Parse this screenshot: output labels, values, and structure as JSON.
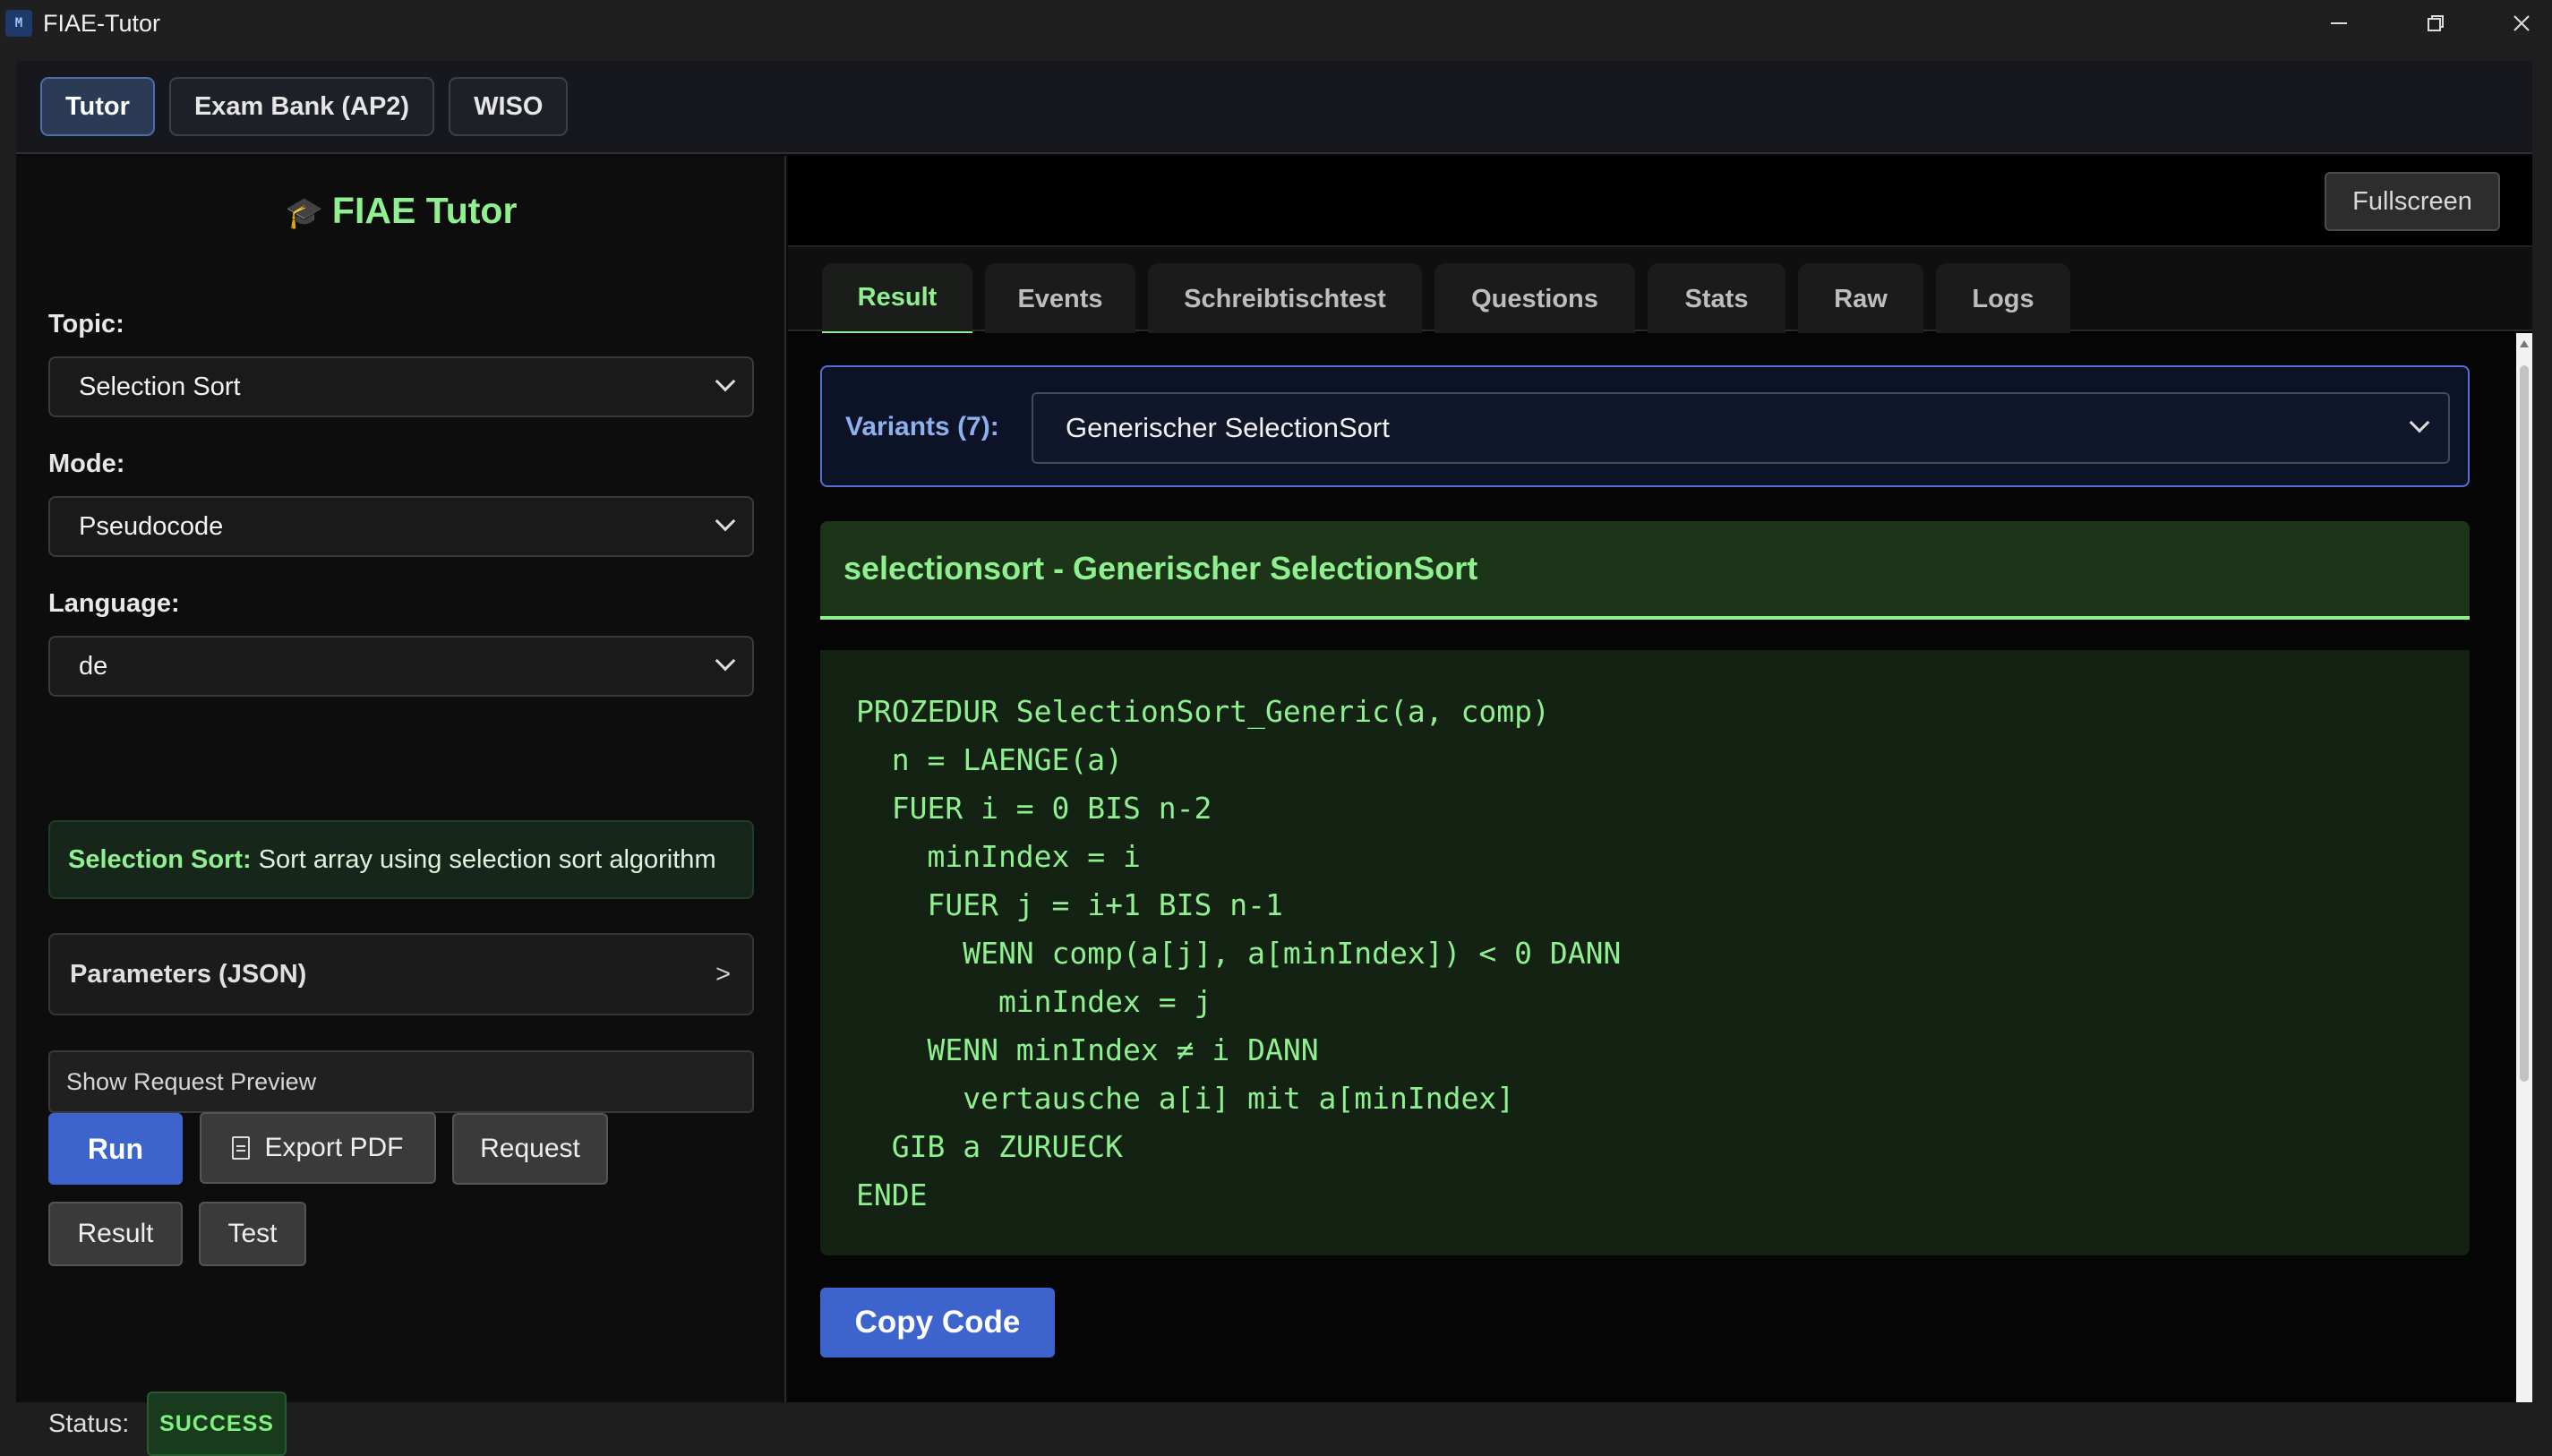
{
  "window": {
    "title": "FIAE-Tutor",
    "icon_text": "M"
  },
  "topnav": {
    "tabs": [
      {
        "label": "Tutor",
        "active": true
      },
      {
        "label": "Exam Bank (AP2)",
        "active": false
      },
      {
        "label": "WISO",
        "active": false
      }
    ]
  },
  "sidebar": {
    "brand_icon": "graduation-cap-icon",
    "brand_title": "FIAE Tutor",
    "topic": {
      "label": "Topic:",
      "value": "Selection Sort"
    },
    "mode": {
      "label": "Mode:",
      "value": "Pseudocode"
    },
    "language": {
      "label": "Language:",
      "value": "de"
    },
    "info": {
      "name": "Selection Sort:",
      "description": "Sort array using selection sort algorithm"
    },
    "params": {
      "label": "Parameters (JSON)",
      "arrow": ">"
    },
    "preview_label": "Show Request Preview",
    "buttons": {
      "run": "Run",
      "export_pdf": "Export PDF",
      "request": "Request",
      "result": "Result",
      "test": "Test"
    },
    "status": {
      "label": "Status:",
      "value": "SUCCESS",
      "color": "#7ef07e"
    }
  },
  "main": {
    "fullscreen_label": "Fullscreen",
    "tabs": [
      {
        "label": "Result",
        "active": true
      },
      {
        "label": "Events",
        "active": false
      },
      {
        "label": "Schreibtischtest",
        "active": false
      },
      {
        "label": "Questions",
        "active": false
      },
      {
        "label": "Stats",
        "active": false
      },
      {
        "label": "Raw",
        "active": false
      },
      {
        "label": "Logs",
        "active": false
      }
    ],
    "variants": {
      "label": "Variants (7):",
      "selected": "Generischer SelectionSort"
    },
    "result_title": "selectionsort - Generischer SelectionSort",
    "code_lines": [
      "PROZEDUR SelectionSort_Generic(a, comp)",
      "  n = LAENGE(a)",
      "  FUER i = 0 BIS n-2",
      "    minIndex = i",
      "    FUER j = i+1 BIS n-1",
      "      WENN comp(a[j], a[minIndex]) < 0 DANN",
      "        minIndex = j",
      "    WENN minIndex ≠ i DANN",
      "      vertausche a[i] mit a[minIndex]",
      "  GIB a ZURUECK",
      "ENDE"
    ],
    "copy_label": "Copy Code"
  },
  "colors": {
    "accent_green": "#8ef08e",
    "accent_blue": "#3d64cc"
  }
}
